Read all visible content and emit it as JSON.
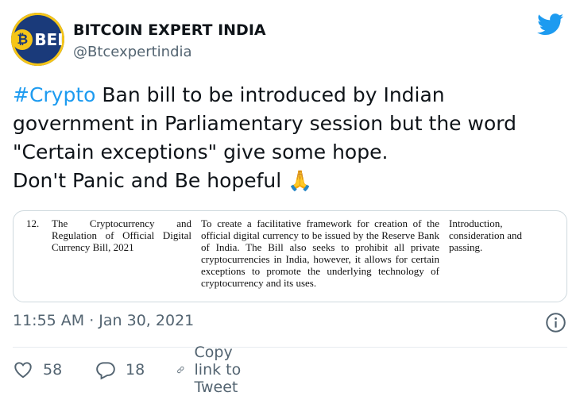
{
  "author": {
    "avatar_text": "BEI",
    "name": "BITCOIN EXPERT INDIA",
    "handle": "@Btcexpertindia"
  },
  "brand_color": "#1d9bf0",
  "tweet": {
    "hashtag": "#Crypto",
    "line1_rest": " Ban bill to be introduced by Indian",
    "line2": "government in Parliamentary session but the word",
    "line3": "\"Certain exceptions\" give some hope.",
    "line4": "Don't Panic and Be hopeful ",
    "emoji": "🙏"
  },
  "document": {
    "number": "12.",
    "bill_title": "The Cryptocurrency and Regulation of Official Digital Currency Bill, 2021",
    "purpose": "To create a facilitative framework for creation of the official digital currency to be issued by the Reserve Bank of India. The Bill also seeks to prohibit all private cryptocurrencies in India, however, it allows for certain exceptions to promote the underlying technology of cryptocurrency and its uses.",
    "stage": "Introduction, consideration and passing."
  },
  "meta": {
    "timestamp": "11:55 AM · Jan 30, 2021"
  },
  "actions": {
    "likes": "58",
    "replies": "18",
    "copy_link": "Copy link to Tweet"
  },
  "icons": [
    "twitter-bird-icon",
    "info-icon",
    "heart-icon",
    "reply-bubble-icon",
    "link-icon"
  ]
}
